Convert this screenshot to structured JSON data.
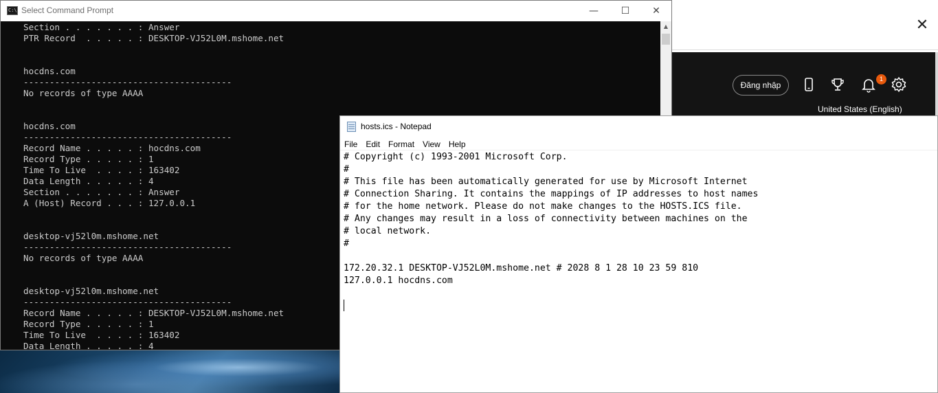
{
  "cmd_window": {
    "title": "Select Command Prompt",
    "icon_text": "C:\\",
    "controls": {
      "minimize": "—",
      "maximize": "☐",
      "close": "✕"
    },
    "lines": [
      "Section . . . . . . . : Answer",
      "PTR Record  . . . . . : DESKTOP-VJ52L0M.mshome.net",
      "",
      "",
      "hocdns.com",
      "----------------------------------------",
      "No records of type AAAA",
      "",
      "",
      "hocdns.com",
      "----------------------------------------",
      "Record Name . . . . . : hocdns.com",
      "Record Type . . . . . : 1",
      "Time To Live  . . . . : 163402",
      "Data Length . . . . . : 4",
      "Section . . . . . . . : Answer",
      "A (Host) Record . . . : 127.0.0.1",
      "",
      "",
      "desktop-vj52l0m.mshome.net",
      "----------------------------------------",
      "No records of type AAAA",
      "",
      "",
      "desktop-vj52l0m.mshome.net",
      "----------------------------------------",
      "Record Name . . . . . : DESKTOP-VJ52L0M.mshome.net",
      "Record Type . . . . . : 1",
      "Time To Live  . . . . : 163402",
      "Data Length . . . . . : 4"
    ]
  },
  "browser": {
    "close_glyph": "✕",
    "login_label": "Đăng nhập",
    "notification_count": "1",
    "language": "United States (English)"
  },
  "notepad": {
    "title": "hosts.ics - Notepad",
    "menu": [
      "File",
      "Edit",
      "Format",
      "View",
      "Help"
    ],
    "lines": [
      "# Copyright (c) 1993-2001 Microsoft Corp.",
      "#",
      "# This file has been automatically generated for use by Microsoft Internet",
      "# Connection Sharing. It contains the mappings of IP addresses to host names",
      "# for the home network. Please do not make changes to the HOSTS.ICS file.",
      "# Any changes may result in a loss of connectivity between machines on the",
      "# local network.",
      "#",
      "",
      "172.20.32.1 DESKTOP-VJ52L0M.mshome.net # 2028 8 1 28 10 23 59 810",
      "127.0.0.1 hocdns.com",
      "",
      ""
    ]
  }
}
